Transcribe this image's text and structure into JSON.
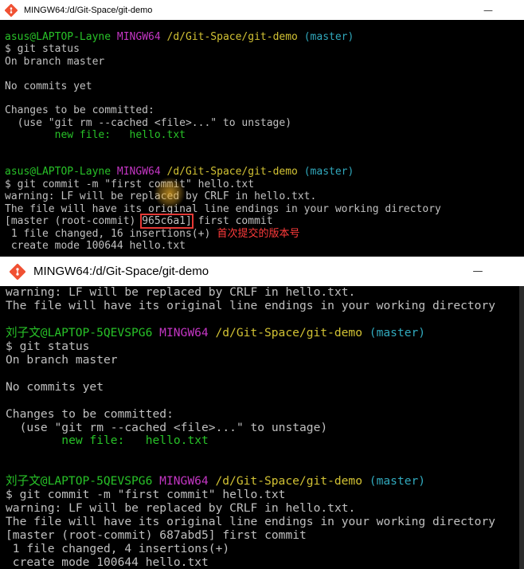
{
  "window1": {
    "title": "MINGW64:/d/Git-Space/git-demo",
    "minimize_glyph": "—",
    "lines": [
      {
        "spans": [
          {
            "t": "asus@LAPTOP-Layne",
            "c": "g"
          },
          {
            "t": " "
          },
          {
            "t": "MINGW64",
            "c": "m"
          },
          {
            "t": " "
          },
          {
            "t": "/d/Git-Space/git-demo",
            "c": "y"
          },
          {
            "t": " "
          },
          {
            "t": "(master)",
            "c": "c"
          }
        ]
      },
      {
        "spans": [
          {
            "t": "$ git status"
          }
        ]
      },
      {
        "spans": [
          {
            "t": "On branch master"
          }
        ]
      },
      {
        "spans": [
          {
            "t": ""
          }
        ]
      },
      {
        "spans": [
          {
            "t": "No commits yet"
          }
        ]
      },
      {
        "spans": [
          {
            "t": ""
          }
        ]
      },
      {
        "spans": [
          {
            "t": "Changes to be committed:"
          }
        ]
      },
      {
        "spans": [
          {
            "t": "  (use \"git rm --cached <file>...\" to unstage)"
          }
        ]
      },
      {
        "spans": [
          {
            "t": "        new file:   hello.txt",
            "c": "g"
          }
        ]
      },
      {
        "spans": [
          {
            "t": ""
          }
        ]
      },
      {
        "spans": [
          {
            "t": ""
          }
        ]
      },
      {
        "spans": [
          {
            "t": "asus@LAPTOP-Layne",
            "c": "g"
          },
          {
            "t": " "
          },
          {
            "t": "MINGW64",
            "c": "m"
          },
          {
            "t": " "
          },
          {
            "t": "/d/Git-Space/git-demo",
            "c": "y"
          },
          {
            "t": " "
          },
          {
            "t": "(master)",
            "c": "c"
          }
        ]
      },
      {
        "spans": [
          {
            "t": "$ git commit -m \"first commit\" hello.txt"
          }
        ]
      },
      {
        "spans": [
          {
            "t": "warning: LF will be replaced by CRLF in hello.txt."
          }
        ]
      },
      {
        "spans": [
          {
            "t": "The file will have its original line endings in your working directory"
          }
        ]
      },
      {
        "spans": [
          {
            "t": "[master (root-commit) "
          },
          {
            "t": "965c6a1]",
            "c": "hl"
          },
          {
            "t": " first commit"
          }
        ]
      },
      {
        "spans": [
          {
            "t": " 1 file changed, 16 insertions(+)"
          },
          {
            "t": "  首次提交的版本号",
            "c": "anno"
          }
        ]
      },
      {
        "spans": [
          {
            "t": " create mode 100644 hello.txt"
          }
        ]
      }
    ]
  },
  "window2": {
    "title": "MINGW64:/d/Git-Space/git-demo",
    "minimize_glyph": "—",
    "lines": [
      {
        "spans": [
          {
            "t": "warning: LF will be replaced by CRLF in hello.txt."
          }
        ]
      },
      {
        "spans": [
          {
            "t": "The file will have its original line endings in your working directory"
          }
        ]
      },
      {
        "spans": [
          {
            "t": ""
          }
        ]
      },
      {
        "spans": [
          {
            "t": "刘子文@LAPTOP-5QEVSPG6",
            "c": "g"
          },
          {
            "t": " "
          },
          {
            "t": "MINGW64",
            "c": "m"
          },
          {
            "t": " "
          },
          {
            "t": "/d/Git-Space/git-demo",
            "c": "y"
          },
          {
            "t": " "
          },
          {
            "t": "(master)",
            "c": "c"
          }
        ]
      },
      {
        "spans": [
          {
            "t": "$ git status"
          }
        ]
      },
      {
        "spans": [
          {
            "t": "On branch master"
          }
        ]
      },
      {
        "spans": [
          {
            "t": ""
          }
        ]
      },
      {
        "spans": [
          {
            "t": "No commits yet"
          }
        ]
      },
      {
        "spans": [
          {
            "t": ""
          }
        ]
      },
      {
        "spans": [
          {
            "t": "Changes to be committed:"
          }
        ]
      },
      {
        "spans": [
          {
            "t": "  (use \"git rm --cached <file>...\" to unstage)"
          }
        ]
      },
      {
        "spans": [
          {
            "t": "        new file:   hello.txt",
            "c": "g"
          }
        ]
      },
      {
        "spans": [
          {
            "t": ""
          }
        ]
      },
      {
        "spans": [
          {
            "t": ""
          }
        ]
      },
      {
        "spans": [
          {
            "t": "刘子文@LAPTOP-5QEVSPG6",
            "c": "g"
          },
          {
            "t": " "
          },
          {
            "t": "MINGW64",
            "c": "m"
          },
          {
            "t": " "
          },
          {
            "t": "/d/Git-Space/git-demo",
            "c": "y"
          },
          {
            "t": " "
          },
          {
            "t": "(master)",
            "c": "c"
          }
        ]
      },
      {
        "spans": [
          {
            "t": "$ git commit -m \"first commit\" hello.txt"
          }
        ]
      },
      {
        "spans": [
          {
            "t": "warning: LF will be replaced by CRLF in hello.txt."
          }
        ]
      },
      {
        "spans": [
          {
            "t": "The file will have its original line endings in your working directory"
          }
        ]
      },
      {
        "spans": [
          {
            "t": "[master (root-commit) 687abd5] first commit"
          }
        ]
      },
      {
        "spans": [
          {
            "t": " 1 file changed, 4 insertions(+)"
          }
        ]
      },
      {
        "spans": [
          {
            "t": " create mode 100644 hello.txt"
          }
        ]
      }
    ]
  }
}
